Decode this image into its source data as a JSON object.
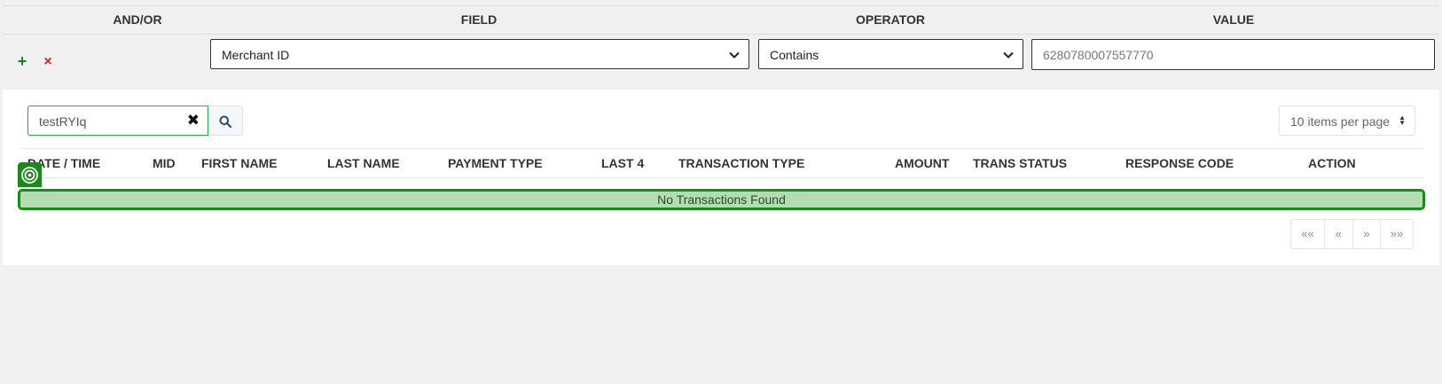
{
  "filter": {
    "headers": {
      "andor": "AND/OR",
      "field": "FIELD",
      "operator": "OPERATOR",
      "value": "VALUE"
    },
    "add_label": "+",
    "remove_label": "×",
    "field_selected": "Merchant ID",
    "operator_selected": "Contains",
    "value_input": "6280780007557770"
  },
  "search": {
    "value": "testRYIq"
  },
  "per_page": {
    "selected": "10 items per page"
  },
  "table": {
    "columns": [
      "DATE / TIME",
      "MID",
      "FIRST NAME",
      "LAST NAME",
      "PAYMENT TYPE",
      "LAST 4",
      "TRANSACTION TYPE",
      "AMOUNT",
      "TRANS STATUS",
      "RESPONSE CODE",
      "ACTION"
    ],
    "empty_message": "No Transactions Found"
  },
  "pagination": {
    "first": "««",
    "prev": "«",
    "next": "»",
    "last": "»»"
  },
  "colors": {
    "highlight_border": "#1a8a1a",
    "highlight_fill": "#b2dcb2",
    "add": "#1e7e1e",
    "remove": "#d62020"
  },
  "icons": [
    "plus-icon",
    "close-icon",
    "chevron-down-icon",
    "search-icon",
    "target-icon",
    "sort-arrows-icon"
  ]
}
